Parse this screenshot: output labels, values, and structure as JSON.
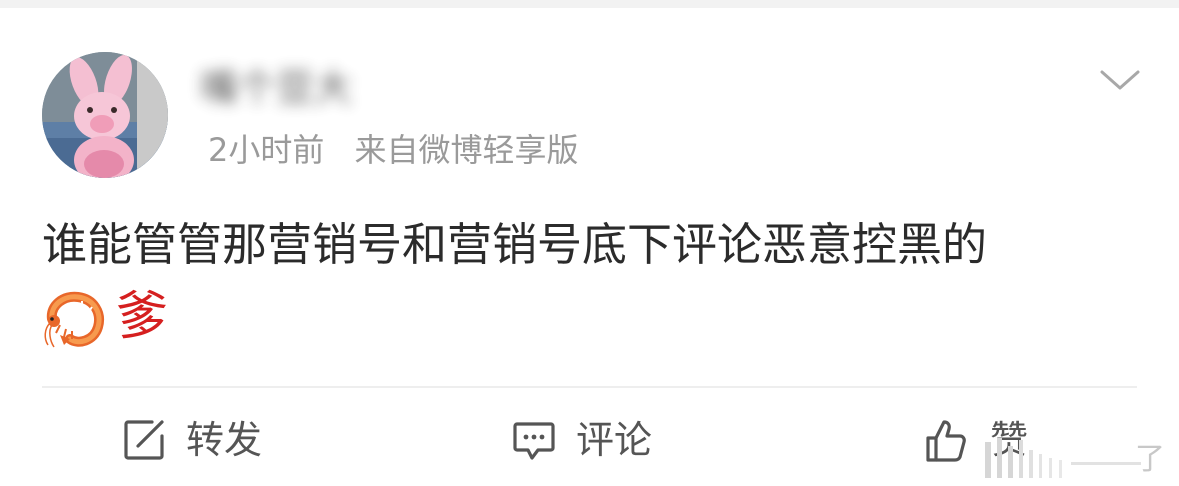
{
  "post": {
    "username": "嘴个豆大",
    "time": "2小时前",
    "source": "来自微博轻享版",
    "text": "谁能管管那营销号和营销号底下评论恶意控黑的",
    "emoji_char": "爹",
    "emoji_icon": "shrimp-icon"
  },
  "actions": {
    "repost_label": "转发",
    "comment_label": "评论",
    "like_label": "赞"
  },
  "watermark": {
    "text": "了"
  },
  "colors": {
    "text_primary": "#2b2b2b",
    "text_meta": "#9a9a9a",
    "accent_red": "#d51f1f",
    "divider": "#eeeeee"
  }
}
